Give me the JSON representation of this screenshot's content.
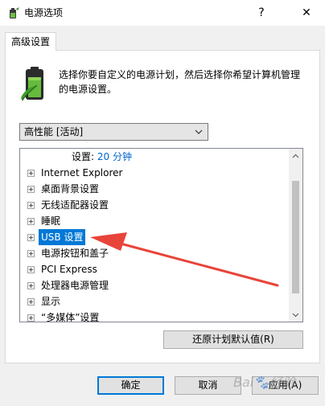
{
  "window": {
    "title": "电源选项",
    "help_glyph": "?",
    "close_glyph": "✕"
  },
  "tab": {
    "label": "高级设置"
  },
  "description": "选择你要自定义的电源计划，然后选择你希望计算机管理的电源设置。",
  "plan_select": {
    "value": "高性能 [活动]"
  },
  "tree": {
    "partial_setting": {
      "label": "设置:",
      "value": "20 分钟"
    },
    "items": [
      {
        "label": "Internet Explorer"
      },
      {
        "label": "桌面背景设置"
      },
      {
        "label": "无线适配器设置"
      },
      {
        "label": "睡眠"
      },
      {
        "label": "USB 设置",
        "selected": true
      },
      {
        "label": "电源按钮和盖子"
      },
      {
        "label": "PCI Express"
      },
      {
        "label": "处理器电源管理"
      },
      {
        "label": "显示"
      },
      {
        "label": "“多媒体”设置"
      }
    ]
  },
  "buttons": {
    "restore": "还原计划默认值(R)",
    "ok": "确定",
    "cancel": "取消",
    "apply": "应用(A)"
  },
  "watermark": "Bai🐾经验",
  "colors": {
    "selection": "#0078d7",
    "value_text": "#0066cc",
    "annotation_arrow": "#e8443a"
  }
}
